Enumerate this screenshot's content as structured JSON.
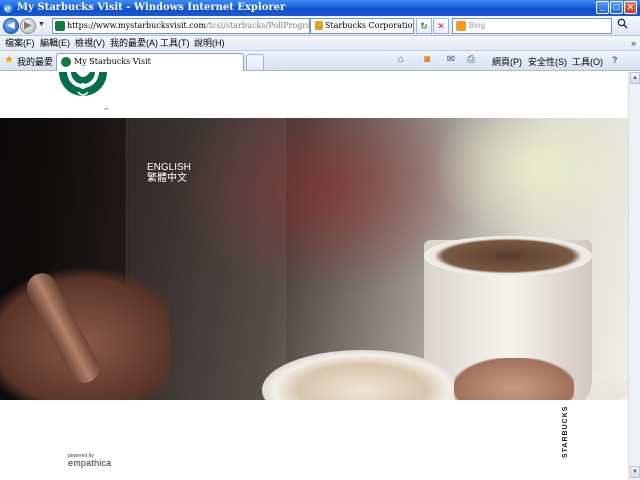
{
  "window": {
    "title": "My Starbucks Visit - Windows Internet Explorer",
    "minimize": "_",
    "maximize": "□",
    "close": "✕"
  },
  "address_bar": {
    "back_glyph": "◀",
    "forward_glyph": "▶",
    "dropdown_glyph": "▼",
    "url_host": "https://www.mystarbucksvisit.com",
    "url_path": "/tcsi/starbucks/PollProgramSurveyRouting.p",
    "security_identity": "Starbucks Corporation [US]",
    "refresh_glyph": "↻",
    "stop_glyph": "✕",
    "search_placeholder": "Bing",
    "search_go_glyph": "🔍"
  },
  "menu": {
    "items": [
      "檔案(F)",
      "編輯(E)",
      "檢視(V)",
      "我的最愛(A)",
      "工具(T)",
      "說明(H)"
    ],
    "overflow_glyph": "»"
  },
  "favorites_bar": {
    "favorites_label": "我的最愛",
    "tab_title": "My Starbucks Visit",
    "commands": [
      "網頁(P)",
      "安全性(S)",
      "工具(O)"
    ],
    "help_glyph": "?"
  },
  "page": {
    "languages": [
      "ENGLISH",
      "繁體中文"
    ],
    "brand_vertical": "STARBUCKS",
    "powered_by": "powered by",
    "vendor": "empathica"
  },
  "colors": {
    "starbucks_green": "#00704a",
    "titlebar_blue": "#1c5fd8"
  },
  "icons": {
    "favorites": "star-icon",
    "home": "home-icon",
    "feeds": "rss-icon",
    "mail": "mail-icon",
    "print": "printer-icon"
  }
}
